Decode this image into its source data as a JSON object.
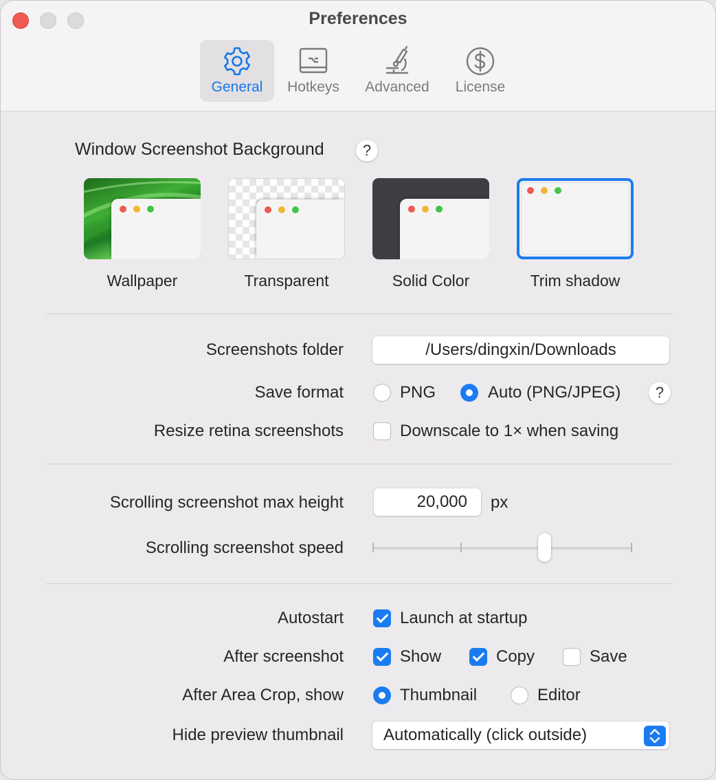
{
  "window": {
    "title": "Preferences"
  },
  "tabs": [
    {
      "label": "General",
      "icon": "gear-icon",
      "active": true
    },
    {
      "label": "Hotkeys",
      "icon": "keyboard-icon",
      "active": false
    },
    {
      "label": "Advanced",
      "icon": "microscope-icon",
      "active": false
    },
    {
      "label": "License",
      "icon": "dollar-icon",
      "active": false
    }
  ],
  "background": {
    "title": "Window Screenshot Background",
    "help": "?",
    "options": [
      {
        "label": "Wallpaper",
        "selected": false
      },
      {
        "label": "Transparent",
        "selected": false
      },
      {
        "label": "Solid Color",
        "selected": false
      },
      {
        "label": "Trim shadow",
        "selected": true
      }
    ]
  },
  "files": {
    "folder_label": "Screenshots folder",
    "folder_value": "/Users/dingxin/Downloads",
    "format_label": "Save format",
    "format_png": "PNG",
    "format_auto": "Auto (PNG/JPEG)",
    "format_selected": "Auto (PNG/JPEG)",
    "format_help": "?",
    "resize_label": "Resize retina screenshots",
    "resize_option": "Downscale to 1× when saving",
    "resize_checked": false
  },
  "scrolling": {
    "max_height_label": "Scrolling screenshot max height",
    "max_height_value": "20,000",
    "max_height_unit": "px",
    "speed_label": "Scrolling screenshot speed",
    "speed_level": 0.66
  },
  "behavior": {
    "autostart_label": "Autostart",
    "autostart_option": "Launch at startup",
    "autostart_checked": true,
    "after_label": "After screenshot",
    "after_show": "Show",
    "after_show_checked": true,
    "after_copy": "Copy",
    "after_copy_checked": true,
    "after_save": "Save",
    "after_save_checked": false,
    "crop_label": "After Area Crop, show",
    "crop_thumbnail": "Thumbnail",
    "crop_editor": "Editor",
    "crop_selected": "Thumbnail",
    "hide_label": "Hide preview thumbnail",
    "hide_value": "Automatically (click outside)"
  },
  "colors": {
    "accent": "#1a7cf0",
    "traffic_red": "#ee5a52",
    "dot_yellow": "#f2b635",
    "dot_green": "#40c645"
  }
}
